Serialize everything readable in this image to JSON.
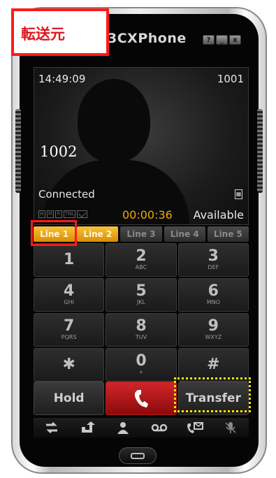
{
  "annotation": {
    "origin_label": "転送元"
  },
  "app": {
    "title": "3CXPhone"
  },
  "window_buttons": {
    "help": "?",
    "minimize": "_",
    "close": "x"
  },
  "screen": {
    "time": "14:49:09",
    "extension": "1001",
    "caller_number": "1002",
    "status": "Connected",
    "indicators": [
      "H",
      "M",
      "R",
      "TNL"
    ],
    "call_timer": "00:00:36",
    "presence": "Available"
  },
  "lines": [
    {
      "label": "Line 1",
      "active": true
    },
    {
      "label": "Line 2",
      "active": true
    },
    {
      "label": "Line 3",
      "active": false
    },
    {
      "label": "Line 4",
      "active": false
    },
    {
      "label": "Line 5",
      "active": false
    }
  ],
  "keypad": [
    {
      "digit": "1",
      "letters": ""
    },
    {
      "digit": "2",
      "letters": "ABC"
    },
    {
      "digit": "3",
      "letters": "DEF"
    },
    {
      "digit": "4",
      "letters": "GHI"
    },
    {
      "digit": "5",
      "letters": "JKL"
    },
    {
      "digit": "6",
      "letters": "MNO"
    },
    {
      "digit": "7",
      "letters": "PQRS"
    },
    {
      "digit": "8",
      "letters": "TUV"
    },
    {
      "digit": "9",
      "letters": "WXYZ"
    },
    {
      "digit": "✱",
      "letters": ""
    },
    {
      "digit": "0",
      "letters": "+"
    },
    {
      "digit": "#",
      "letters": ""
    }
  ],
  "actions": {
    "hold": "Hold",
    "transfer": "Transfer"
  },
  "bottom_icons": [
    "switch-call-icon",
    "forward-icon",
    "contacts-icon",
    "voicemail-icon",
    "message-icon",
    "mute-icon"
  ],
  "colors": {
    "accent_orange": "#f0a800",
    "call_red": "#c81e22",
    "annotation_red": "#ff1a1a",
    "annotation_yellow": "#ffe600"
  }
}
